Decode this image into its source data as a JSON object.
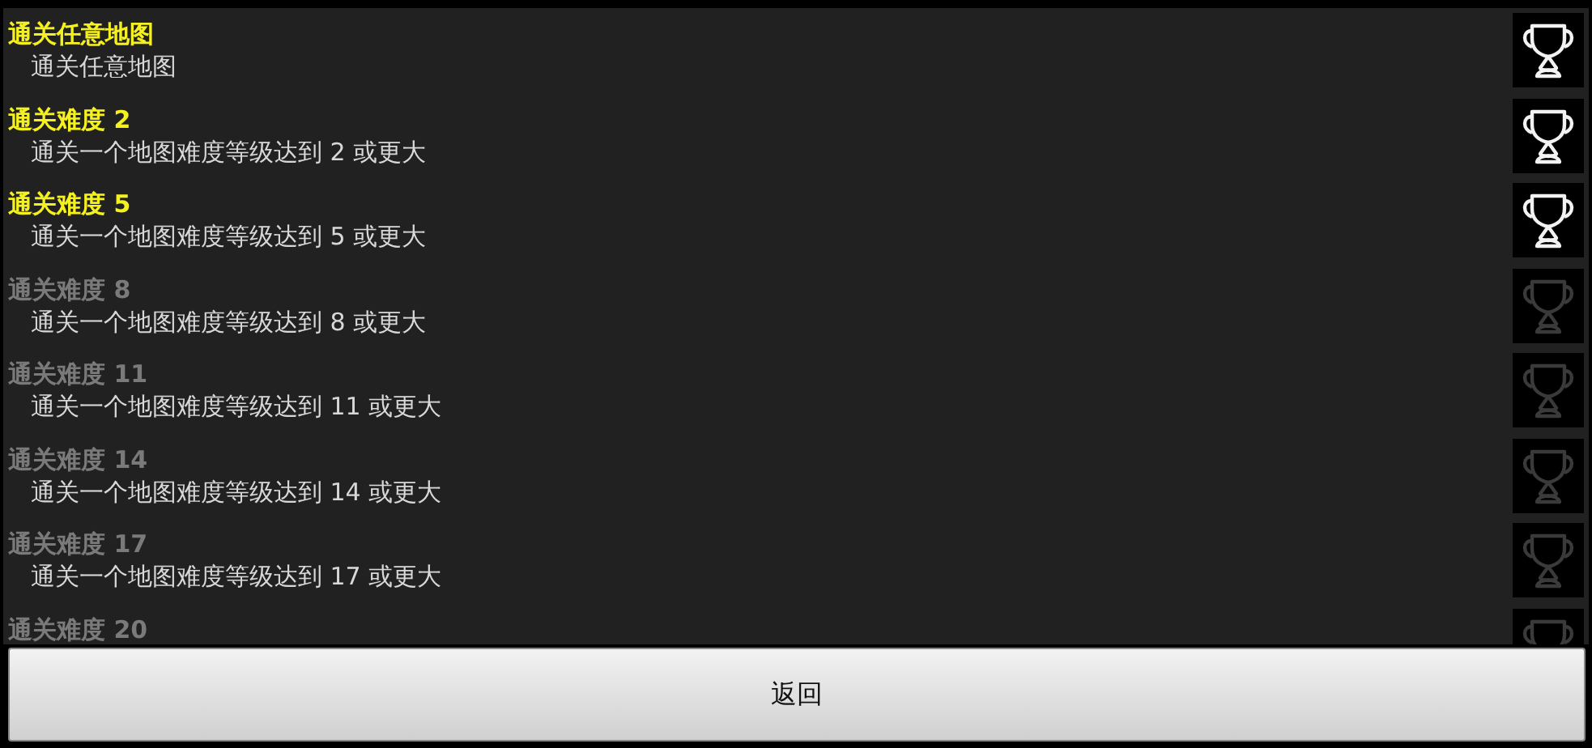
{
  "achievements": [
    {
      "title": "通关任意地图",
      "description": "通关任意地图",
      "unlocked": true
    },
    {
      "title": "通关难度 2",
      "description": "通关一个地图难度等级达到 2 或更大",
      "unlocked": true
    },
    {
      "title": "通关难度 5",
      "description": "通关一个地图难度等级达到 5 或更大",
      "unlocked": true
    },
    {
      "title": "通关难度 8",
      "description": "通关一个地图难度等级达到 8 或更大",
      "unlocked": false
    },
    {
      "title": "通关难度 11",
      "description": "通关一个地图难度等级达到 11 或更大",
      "unlocked": false
    },
    {
      "title": "通关难度 14",
      "description": "通关一个地图难度等级达到 14 或更大",
      "unlocked": false
    },
    {
      "title": "通关难度 17",
      "description": "通关一个地图难度等级达到 17 或更大",
      "unlocked": false
    },
    {
      "title": "通关难度 20",
      "unlocked": false
    }
  ],
  "back_button": "返回"
}
